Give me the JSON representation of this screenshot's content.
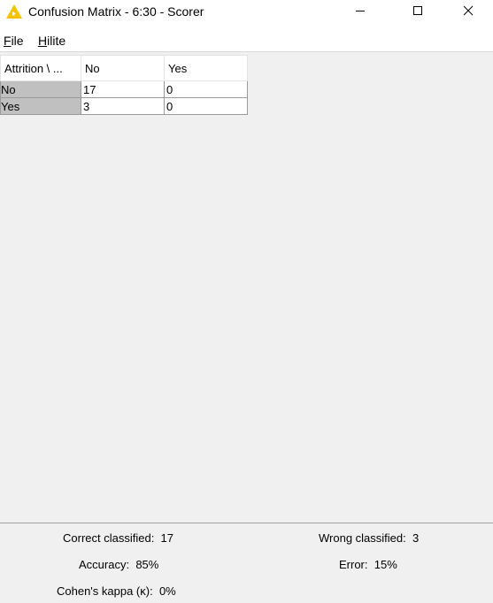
{
  "window": {
    "title": "Confusion Matrix - 6:30 - Scorer",
    "icon": "knime-warning-triangle-icon",
    "controls": [
      "minimize",
      "maximize",
      "close"
    ]
  },
  "menu": {
    "file": {
      "mnemonic": "F",
      "rest": "ile"
    },
    "hilite": {
      "mnemonic": "H",
      "rest": "ilite"
    }
  },
  "matrix": {
    "corner_header": "Attrition \\ ...",
    "columns": [
      "No",
      "Yes"
    ],
    "rows": [
      {
        "label": "No",
        "values": [
          "17",
          "0"
        ]
      },
      {
        "label": "Yes",
        "values": [
          "3",
          "0"
        ]
      }
    ]
  },
  "stats": {
    "correct_label": "Correct classified:",
    "correct_value": "17",
    "wrong_label": "Wrong classified:",
    "wrong_value": "3",
    "accuracy_label": "Accuracy:",
    "accuracy_value": "85%",
    "error_label": "Error:",
    "error_value": "15%",
    "kappa_label": "Cohen's kappa (κ):",
    "kappa_value": "0%"
  },
  "colors": {
    "row_header_bg": "#c0c0c0",
    "background": "#f0f0f0",
    "icon_yellow": "#f5c400"
  }
}
